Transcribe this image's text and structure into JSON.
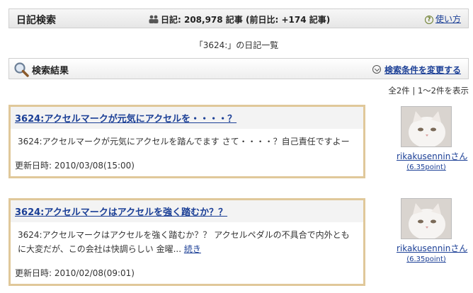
{
  "header": {
    "title": "日記検索",
    "stats": "日記: 208,978 記事 (前日比: +174 記事)",
    "help_label": "使い方"
  },
  "page_heading": "「3624:」の日記一覧",
  "results_bar": {
    "title": "検索結果",
    "change_label": "検索条件を変更する"
  },
  "result_count": "全2件 | 1～2件を表示",
  "entries": [
    {
      "title": "3624:アクセルマークが元気にアクセルを・・・・？",
      "body": "3624:アクセルマークが元気にアクセルを踏んでます さて・・・・？自己責任ですよー",
      "more": "",
      "updated": "更新日時: 2010/03/08(15:00)",
      "user": {
        "name": "rikakusenninさん",
        "points": "(6.35point)"
      }
    },
    {
      "title": "3624:アクセルマークはアクセルを強く踏むか？？",
      "body": "3624:アクセルマークはアクセルを強く踏むか？？ アクセルペダルの不具合で内外ともに大変だが、この会社は快調らしい 金曜...",
      "more": "続き",
      "updated": "更新日時: 2010/02/08(09:01)",
      "user": {
        "name": "rikakusenninさん",
        "points": "(6.35point)"
      }
    }
  ]
}
